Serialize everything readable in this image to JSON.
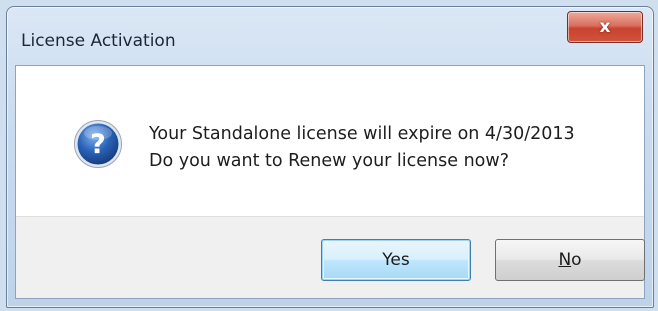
{
  "window": {
    "title": "License Activation",
    "close_glyph": "x"
  },
  "dialog": {
    "icon": "question-icon",
    "icon_glyph": "?",
    "message_line1": "Your Standalone license will expire on 4/30/2013",
    "message_line2": "Do you want to Renew your license now?"
  },
  "buttons": {
    "yes_label": "Yes",
    "no_mnemonic": "N",
    "no_rest": "o"
  },
  "colors": {
    "close_button": "#c8432d",
    "default_button_border": "#3c7fb1",
    "icon_blue": "#2a63b7"
  }
}
